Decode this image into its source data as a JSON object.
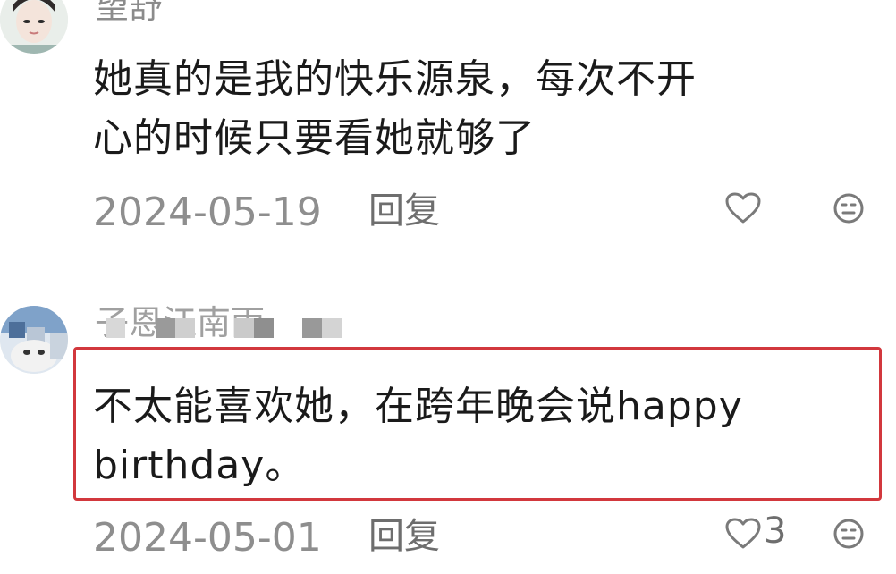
{
  "comments": [
    {
      "username": "望舒",
      "text_line1": "她真的是我的快乐源泉，每次不开",
      "text_line2": "心的时候只要看她就够了",
      "date": "2024-05-19",
      "reply_label": "回复",
      "like_count": ""
    },
    {
      "username": "子恩江南雨",
      "text_line1": "不太能喜欢她，在跨年晚会说happy",
      "text_line2": "birthday。",
      "date": "2024-05-01",
      "reply_label": "回复",
      "like_count": "3"
    }
  ],
  "colors": {
    "highlight_border": "#d2383d",
    "icon_gray": "#7a7a7a"
  },
  "icons": [
    "avatar",
    "heart-icon",
    "emoji-face-icon"
  ]
}
